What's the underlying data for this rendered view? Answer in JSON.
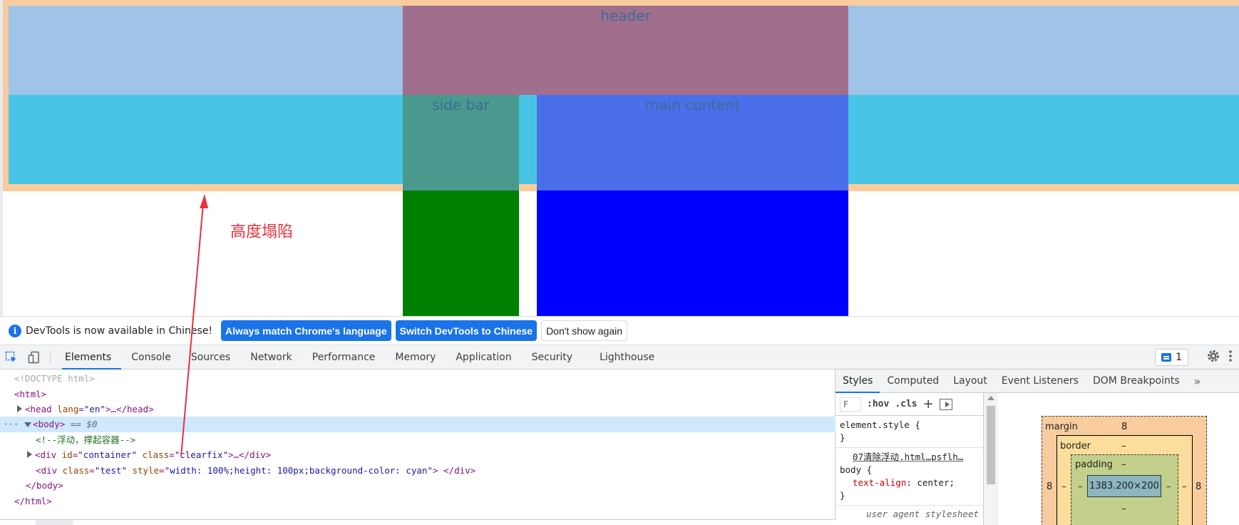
{
  "page": {
    "header_label": "header",
    "sidebar_label": "side bar",
    "main_label": "main content",
    "annotation": "高度塌陷"
  },
  "infobar": {
    "message": "DevTools is now available in Chinese!",
    "btn_match": "Always match Chrome's language",
    "btn_switch": "Switch DevTools to Chinese",
    "btn_dismiss": "Don't show again",
    "icon": "info-icon"
  },
  "devtools": {
    "tabs": [
      "Elements",
      "Console",
      "Sources",
      "Network",
      "Performance",
      "Memory",
      "Application",
      "Security",
      "Lighthouse"
    ],
    "active_tab": "Elements",
    "issues_count": "1"
  },
  "dom": {
    "doctype": "<!DOCTYPE html>",
    "html_open": "<html>",
    "head_tag": "<head",
    "head_attr": "lang",
    "head_val": "\"en\"",
    "head_rest": ">…</head>",
    "body_tag": "<body>",
    "body_eq": "== $0",
    "comment": "<!--浮动，撑起容器-->",
    "div1_open": "<div",
    "div1_attr1": "id",
    "div1_val1": "\"container\"",
    "div1_attr2": "class",
    "div1_val2": "\"clearfix\"",
    "div1_rest": ">…</div>",
    "div2_open": "<div",
    "div2_attr1": "class",
    "div2_val1": "\"test\"",
    "div2_attr2": "style",
    "div2_val2": "\"width: 100%;height: 100px;background-color: cyan\"",
    "div2_rest": "> </div>",
    "body_close": "</body>",
    "html_close": "</html>",
    "dots": "···"
  },
  "styles": {
    "tabs": [
      "Styles",
      "Computed",
      "Layout",
      "Event Listeners",
      "DOM Breakpoints"
    ],
    "active_tab": "Styles",
    "filter_placeholder": "F",
    "hov": ":hov",
    "cls": ".cls",
    "element_style": "element.style {",
    "close_brace": "}",
    "source": "07清除浮动.html…psflh…",
    "body_selector": "body {",
    "prop_name": "text-align",
    "prop_value": "center;",
    "user_agent": "user agent stylesheet"
  },
  "boxmodel": {
    "margin_label": "margin",
    "margin_top": "8",
    "margin_left": "8",
    "margin_right": "8",
    "border_label": "border",
    "border_top": "–",
    "border_left": "–",
    "border_right": "–",
    "padding_label": "padding",
    "padding_top": "–",
    "padding_left": "–",
    "padding_right": "–",
    "padding_bottom": "–",
    "content_size": "1383.200×200"
  },
  "colors": {
    "accent": "#1a73e8",
    "annotation": "#e5333b",
    "sidebar": "#008000",
    "main": "#0000ff",
    "test_div": "cyan"
  }
}
